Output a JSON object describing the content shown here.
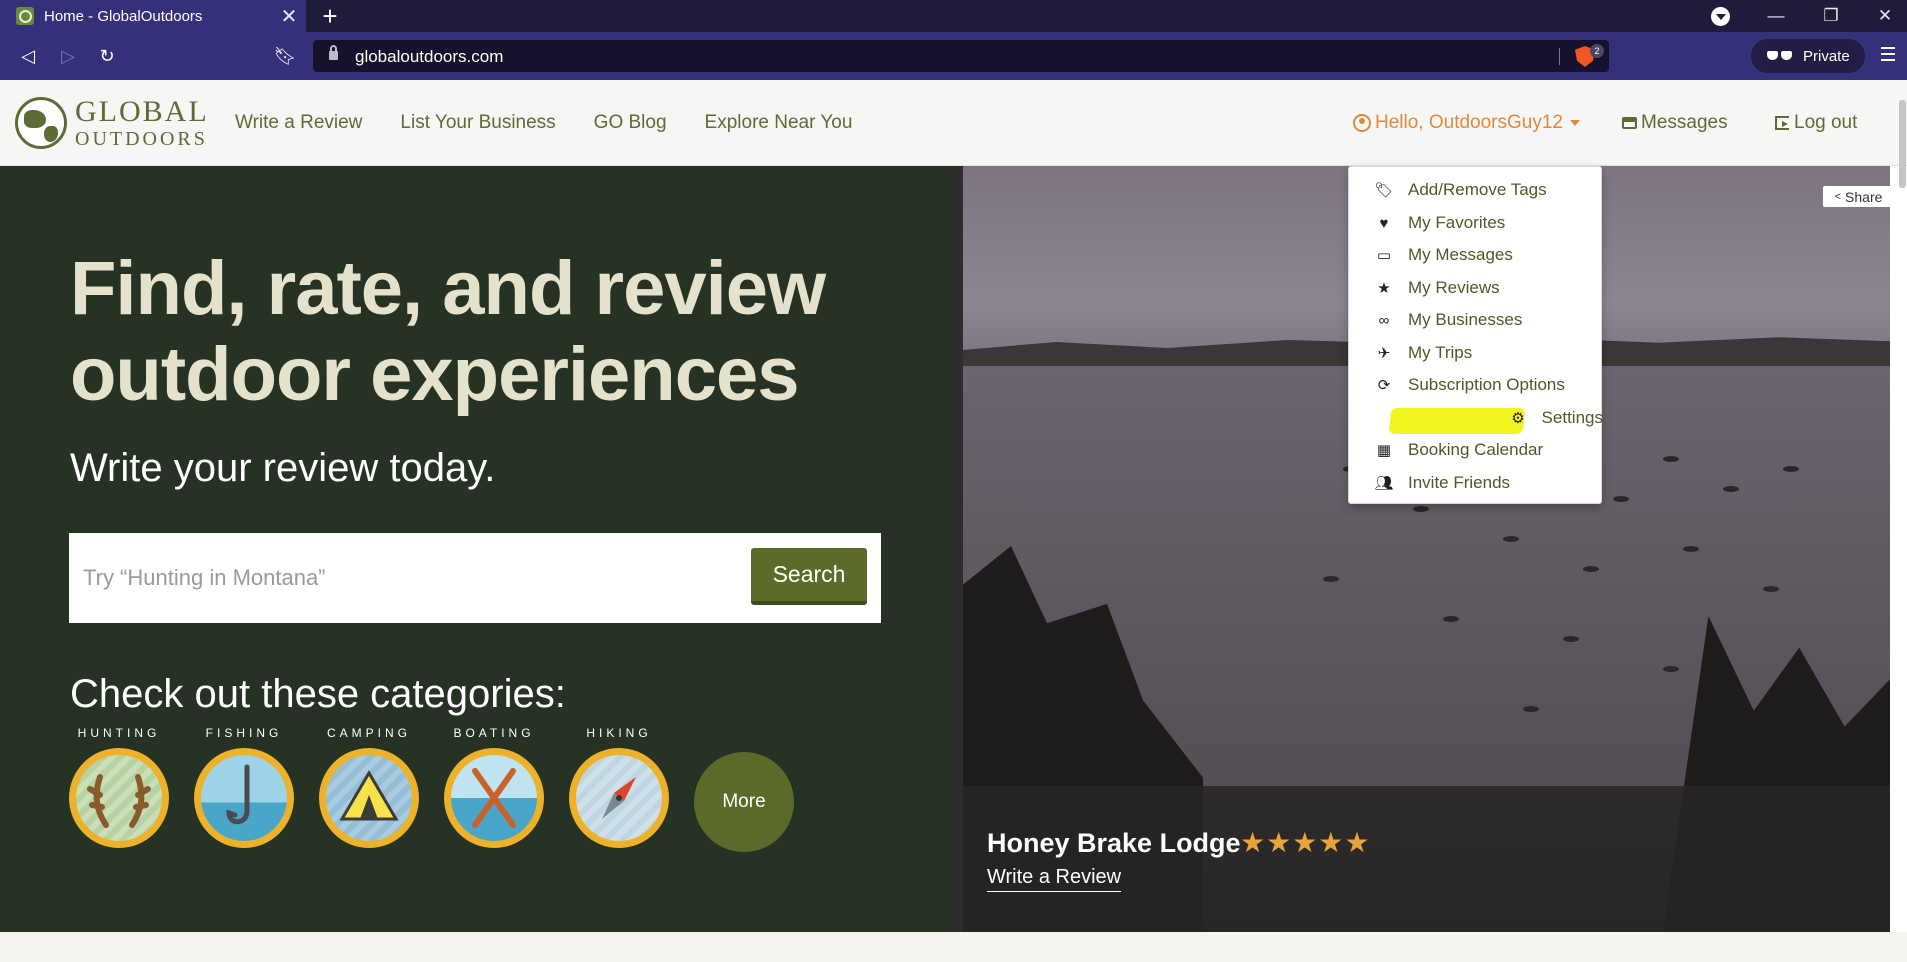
{
  "browser": {
    "tab_title": "Home - GlobalOutdoors",
    "url": "globaloutdoors.com",
    "shield_count": "2",
    "private_label": "Private"
  },
  "site": {
    "logo_line1": "GLOBAL",
    "logo_line2": "OUTDOORS",
    "nav": [
      "Write a Review",
      "List Your Business",
      "GO Blog",
      "Explore Near You"
    ],
    "user_greeting": "Hello, OutdoorsGuy12",
    "messages_label": "Messages",
    "logout_label": "Log out"
  },
  "dropdown": {
    "items": [
      {
        "label": "Add/Remove Tags",
        "icon": "tags-icon"
      },
      {
        "label": "My Favorites",
        "icon": "heart-icon"
      },
      {
        "label": "My Messages",
        "icon": "inbox-icon"
      },
      {
        "label": "My Reviews",
        "icon": "star-icon"
      },
      {
        "label": "My Businesses",
        "icon": "binoculars-icon"
      },
      {
        "label": "My Trips",
        "icon": "plane-icon"
      },
      {
        "label": "Subscription Options",
        "icon": "refresh-icon"
      },
      {
        "label": "Settings",
        "icon": "gear-icon"
      },
      {
        "label": "Booking Calendar",
        "icon": "calendar-icon"
      },
      {
        "label": "Invite Friends",
        "icon": "users-icon"
      }
    ],
    "highlighted_item": "Settings",
    "highlight_color": "#f3f51f"
  },
  "hero": {
    "title": "Find, rate, and review outdoor experiences",
    "subtitle": "Write your review today.",
    "search_placeholder": "Try “Hunting in Montana”",
    "search_button": "Search",
    "categories_title": "Check out these categories:",
    "categories": [
      "HUNTING",
      "FISHING",
      "CAMPING",
      "BOATING",
      "HIKING"
    ],
    "more_label": "More"
  },
  "featured": {
    "name": "Honey Brake Lodge",
    "rating": 5,
    "stars": "★★★★★",
    "write_review": "Write a Review",
    "share_label": "Share"
  },
  "colors": {
    "brand_green": "#5d6b34",
    "hero_bg": "#263224",
    "accent_orange": "#e0893d",
    "badge_gold": "#eeb12a"
  }
}
